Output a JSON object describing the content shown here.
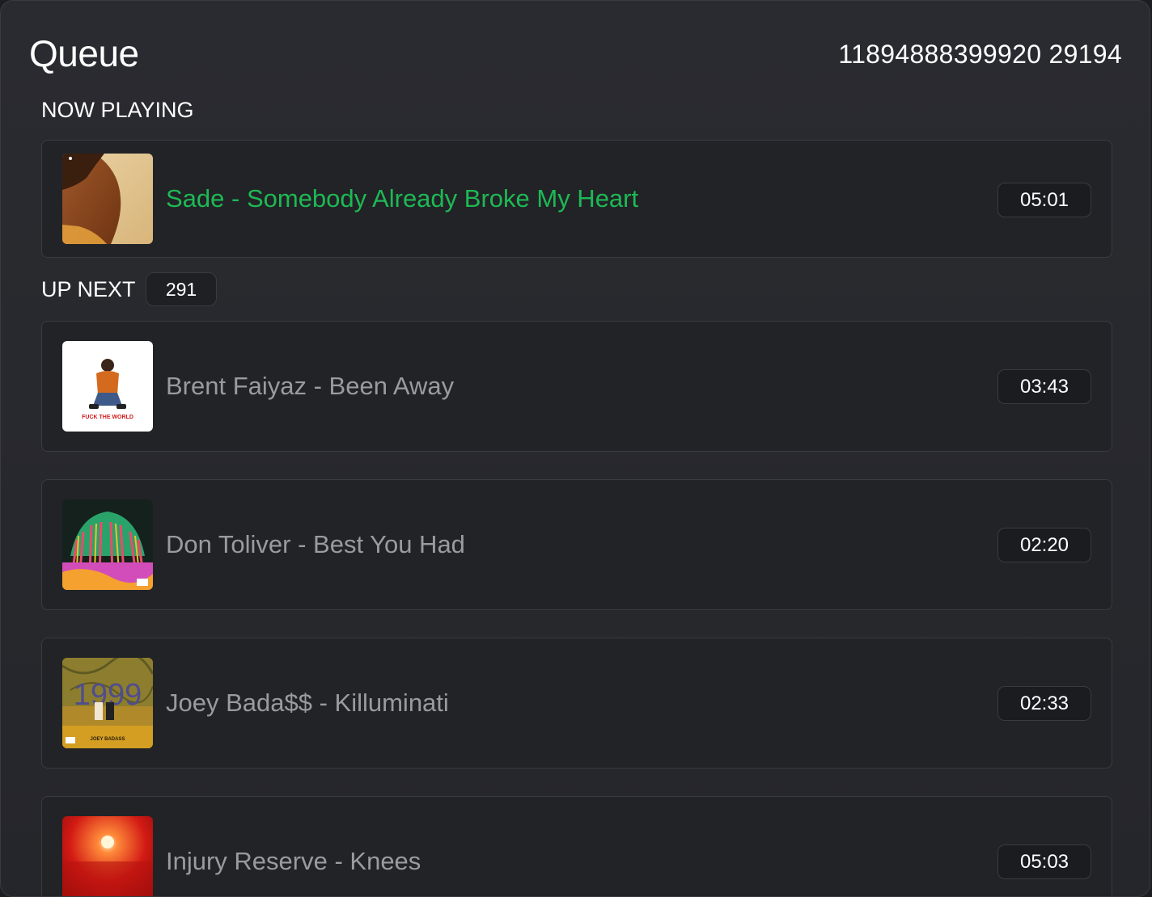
{
  "header": {
    "title": "Queue",
    "queue_id": "11894888399920 29194"
  },
  "now_playing": {
    "label": "NOW PLAYING",
    "track": {
      "title": "Sade - Somebody Already Broke My Heart",
      "duration": "05:01"
    }
  },
  "up_next": {
    "label": "UP NEXT",
    "count": "291",
    "tracks": [
      {
        "title": "Brent Faiyaz - Been Away",
        "duration": "03:43",
        "cover_text": "FUCK THE WORLD"
      },
      {
        "title": "Don Toliver - Best You Had",
        "duration": "02:20"
      },
      {
        "title": "Joey Bada$$ - Killuminati",
        "duration": "02:33",
        "cover_text": "1999",
        "cover_subtext": "JOEY BADASS"
      },
      {
        "title": "Injury Reserve - Knees",
        "duration": "05:03"
      }
    ]
  },
  "colors": {
    "accent": "#1db954",
    "muted_text": "#9a9aa0",
    "background": "#25262b"
  }
}
